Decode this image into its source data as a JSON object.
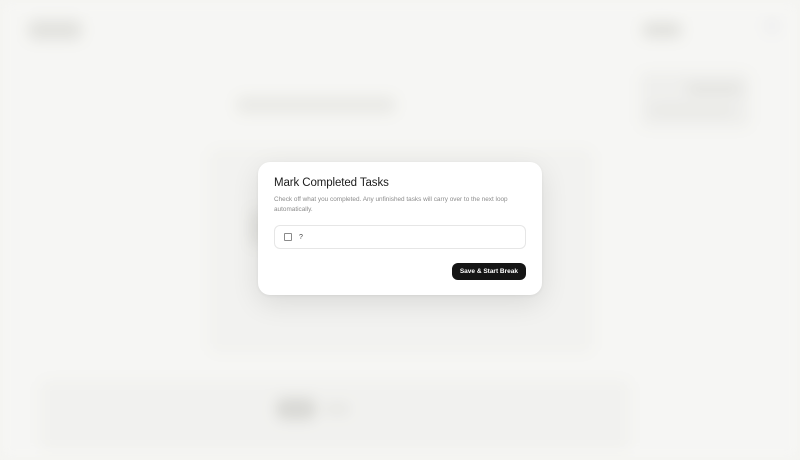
{
  "modal": {
    "title": "Mark Completed Tasks",
    "description": "Check off what you completed. Any unfinished tasks will carry over to the next loop automatically.",
    "tasks": [
      {
        "label": "?",
        "checked": false
      }
    ],
    "primary_button_label": "Save & Start Break"
  },
  "colors": {
    "primary_button_bg": "#151515",
    "backdrop": "#f3f3f1"
  }
}
